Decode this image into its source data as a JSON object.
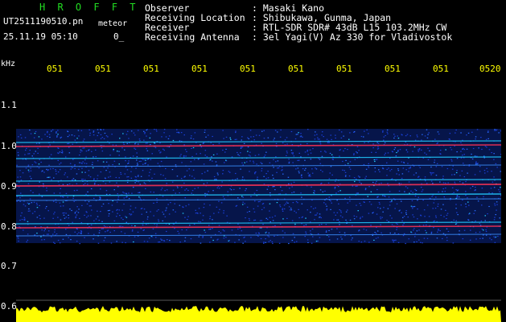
{
  "header": {
    "logo": "H R O F F T",
    "filename": "UT2511190510.pn",
    "filename_tail": "meteor",
    "timestamp": "25.11.19 05:10",
    "timestamp_suffix": "0_",
    "info": [
      {
        "label": "Observer",
        "value": ": Masaki Kano"
      },
      {
        "label": "Receiving Location",
        "value": ": Shibukawa, Gunma, Japan"
      },
      {
        "label": "Receiver",
        "value": ": RTL-SDR SDR# 43dB L15 103.2MHz CW"
      },
      {
        "label": "Receiving Antenna",
        "value": ": 3el Yagi(V) Az 330 for Vladivostok"
      }
    ]
  },
  "time_axis": {
    "ticks": [
      "051",
      "051",
      "051",
      "051",
      "051",
      "051",
      "051",
      "051",
      "051",
      "0520"
    ]
  },
  "freq_axis": {
    "unit": "kHz",
    "ticks": [
      "1.1",
      "1.0",
      "0.9",
      "0.8",
      "0.7",
      "0.6"
    ]
  },
  "colors": {
    "logo": "#22dd22",
    "header_text": "#ffffff",
    "tick_text": "#ffff00",
    "background": "#000000",
    "noise_band": "#1a3fd6",
    "signal_cyan": "#22ccff",
    "signal_red": "#ff3355",
    "floor_yellow": "#ffff00"
  }
}
